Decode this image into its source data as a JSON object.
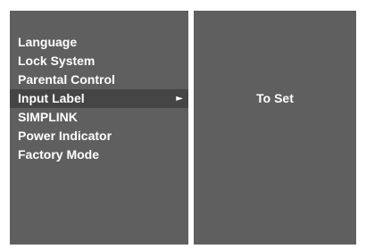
{
  "menu": {
    "items": [
      {
        "label": "Language",
        "selected": false
      },
      {
        "label": "Lock System",
        "selected": false
      },
      {
        "label": "Parental Control",
        "selected": false
      },
      {
        "label": "Input Label",
        "selected": true,
        "arrow": "►"
      },
      {
        "label": "SIMPLINK",
        "selected": false
      },
      {
        "label": "Power Indicator",
        "selected": false
      },
      {
        "label": "Factory Mode",
        "selected": false
      }
    ]
  },
  "submenu": {
    "value": "To Set"
  },
  "colors": {
    "panel_background": "#5f5f5f",
    "selected_background": "#454545",
    "text": "#ffffff"
  }
}
